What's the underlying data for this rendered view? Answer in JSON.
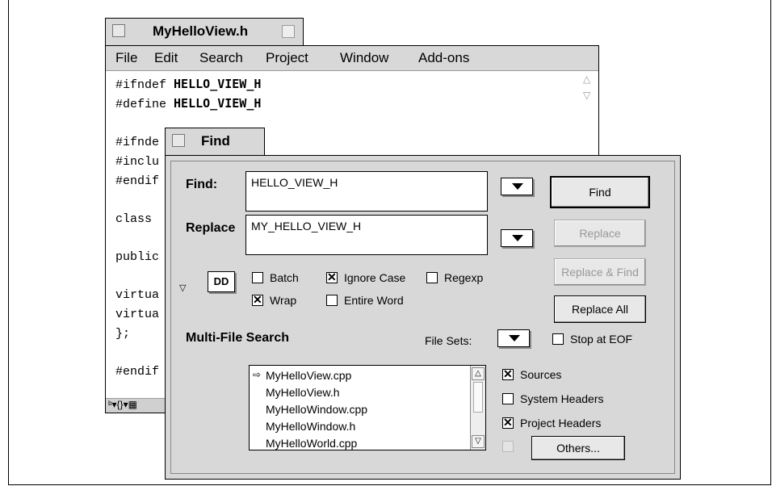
{
  "editor": {
    "title": "MyHelloView.h",
    "menu": [
      "File",
      "Edit",
      "Search",
      "Project",
      "Window",
      "Add-ons"
    ],
    "code_lines": [
      {
        "pre": "#ifndef ",
        "kw": "HELLO_VIEW_H"
      },
      {
        "pre": "#define ",
        "kw": "HELLO_VIEW_H"
      },
      {
        "pre": "",
        "kw": ""
      },
      {
        "pre": "#ifnde",
        "kw": ""
      },
      {
        "pre": "#inclu",
        "kw": ""
      },
      {
        "pre": "#endif",
        "kw": ""
      },
      {
        "pre": "",
        "kw": ""
      },
      {
        "pre": "class ",
        "kw": ""
      },
      {
        "pre": "",
        "kw": ""
      },
      {
        "pre": "public",
        "kw": ""
      },
      {
        "pre": "",
        "kw": ""
      },
      {
        "pre": "virtua",
        "kw": ""
      },
      {
        "pre": "virtua",
        "kw": ""
      },
      {
        "pre": "};",
        "kw": ""
      },
      {
        "pre": "",
        "kw": ""
      },
      {
        "pre": "#endif",
        "kw": ""
      }
    ],
    "status": "ᵇ▾{}▾▦"
  },
  "find_window": {
    "title": "Find",
    "find_label": "Find:",
    "find_value": "HELLO_VIEW_H",
    "replace_label": "Replace",
    "replace_value": "MY_HELLO_VIEW_H",
    "buttons": {
      "find": "Find",
      "replace": "Replace",
      "replace_find": "Replace & Find",
      "replace_all": "Replace All",
      "others": "Others..."
    },
    "options": {
      "batch": {
        "label": "Batch",
        "checked": false
      },
      "ignore_case": {
        "label": "Ignore Case",
        "checked": true
      },
      "regexp": {
        "label": "Regexp",
        "checked": false
      },
      "wrap": {
        "label": "Wrap",
        "checked": true
      },
      "entire_word": {
        "label": "Entire Word",
        "checked": false
      }
    },
    "multi_file_label": "Multi-File Search",
    "file_sets_label": "File Sets:",
    "stop_at_eof": {
      "label": "Stop at EOF",
      "checked": false
    },
    "files": [
      "MyHelloView.cpp",
      "MyHelloView.h",
      "MyHelloWindow.cpp",
      "MyHelloWindow.h",
      "MyHelloWorld.cpp"
    ],
    "sources": {
      "label": "Sources",
      "checked": true
    },
    "system_headers": {
      "label": "System Headers",
      "checked": false
    },
    "project_headers": {
      "label": "Project Headers",
      "checked": true
    }
  }
}
